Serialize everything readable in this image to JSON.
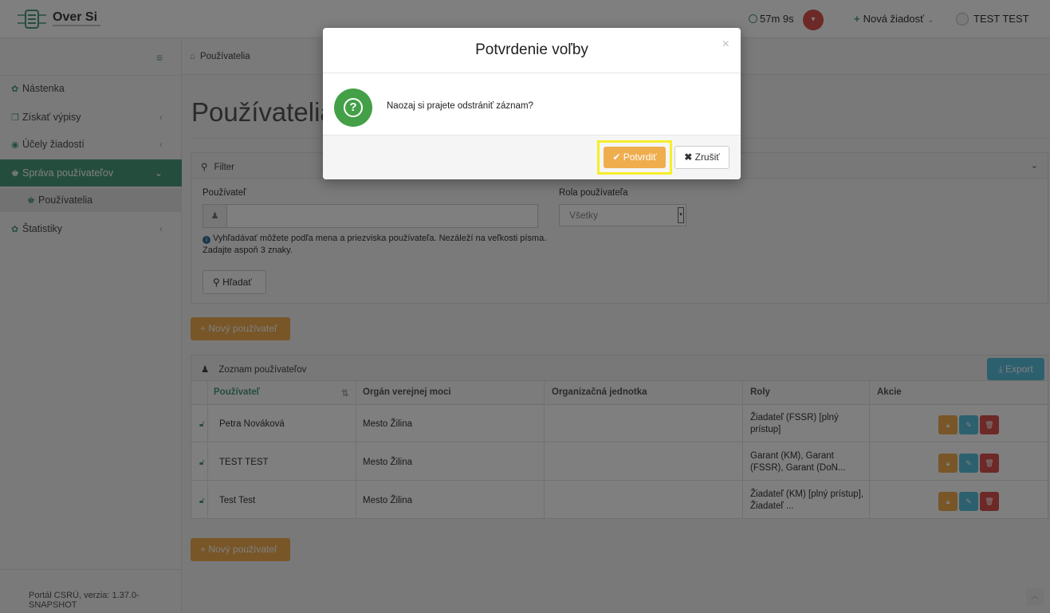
{
  "app": {
    "logo_text": "Over Si"
  },
  "topbar": {
    "timer": "57m 9s",
    "new_request": "Nová žiadosť",
    "user_name": "TEST TEST"
  },
  "sidebar": {
    "items": [
      {
        "label": "Nástenka",
        "icon": "dashboard-icon"
      },
      {
        "label": "Získať výpisy",
        "icon": "documents-icon"
      },
      {
        "label": "Účely žiadostí",
        "icon": "target-icon"
      },
      {
        "label": "Správa používateľov",
        "icon": "users-icon"
      },
      {
        "label": "Používatelia",
        "icon": "users-icon"
      },
      {
        "label": "Štatistiky",
        "icon": "stats-icon"
      }
    ],
    "footer": "Portál CSRÚ, verzia: 1.37.0-SNAPSHOT"
  },
  "breadcrumb": {
    "current": "Používatelia"
  },
  "page": {
    "title": "Používatelia"
  },
  "filter": {
    "header": "Filter",
    "user_label": "Používateľ",
    "user_value": "",
    "role_label": "Rola používateľa",
    "role_value": "Všetky",
    "help_text": "Vyhľadávať môžete podľa mena a priezviska používateľa. Nezáleží na veľkosti písma. Zadajte aspoň 3 znaky.",
    "search_label": "Hľadať"
  },
  "actions": {
    "new_user_label": "Nový používateľ"
  },
  "user_list": {
    "header": "Zoznam používateľov",
    "export_label": "Export",
    "columns": [
      "Používateľ",
      "Orgán verejnej moci",
      "Organizačná jednotka",
      "Roly",
      "Akcie"
    ],
    "rows": [
      {
        "user": "Petra Nováková",
        "org": "Mesto Žilina",
        "unit": "",
        "roles": "Žiadateľ (FSSR) [plný prístup]"
      },
      {
        "user": "TEST TEST",
        "org": "Mesto Žilina",
        "unit": "",
        "roles": "Garant (KM), Garant (FSSR), Garant (DoN..."
      },
      {
        "user": "Test Test",
        "org": "Mesto Žilina",
        "unit": "",
        "roles": "Žiadateľ (KM) [plný prístup], Žiadateľ ..."
      }
    ]
  },
  "modal": {
    "title": "Potvrdenie voľby",
    "message": "Naozaj si prajete odstrániť záznam?",
    "confirm_label": "Potvrdiť",
    "cancel_label": "Zrušiť",
    "close_glyph": "×"
  },
  "colors": {
    "accent": "#4a9b7c",
    "warning": "#f0ad4e",
    "info": "#5bc0de",
    "danger": "#d9534f",
    "highlight": "#f5ee2b"
  }
}
